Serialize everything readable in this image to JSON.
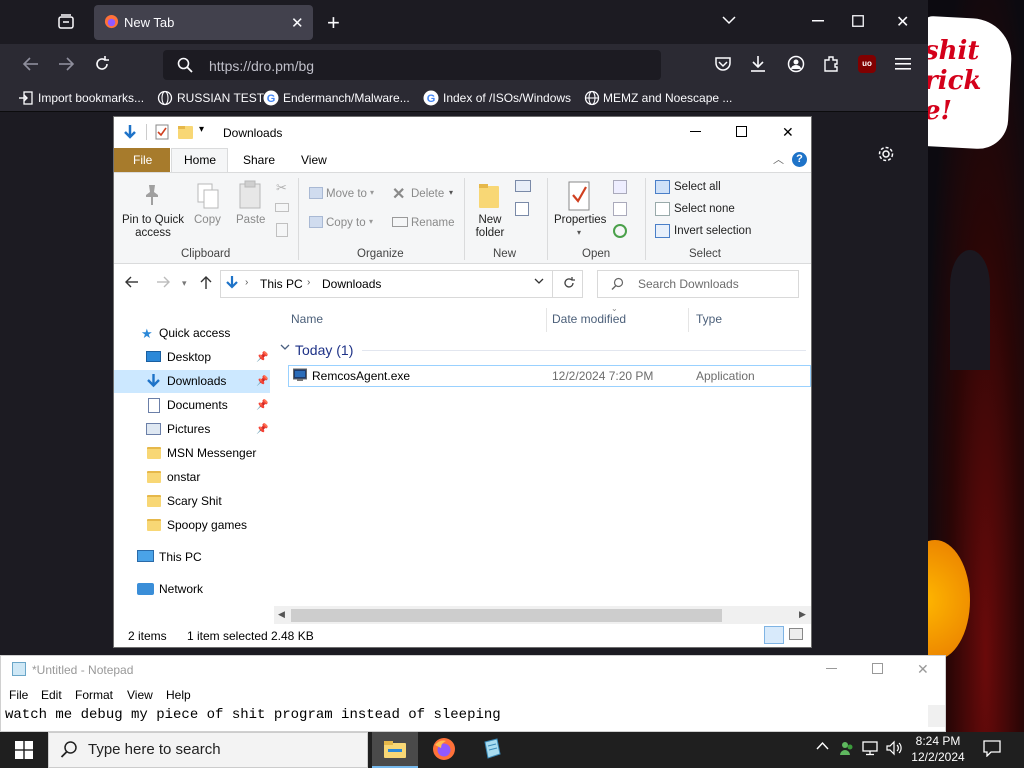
{
  "background_page": {
    "bubble_text": "shit\nrick\ne!"
  },
  "browser": {
    "tab": {
      "title": "New Tab"
    },
    "url": "https://dro.pm/bg",
    "bookmarks": [
      {
        "label": "Import bookmarks...",
        "icon": "import-icon"
      },
      {
        "label": "RUSSIAN TEST",
        "icon": "globe-icon"
      },
      {
        "label": "Endermanch/Malware...",
        "icon": "google-icon"
      },
      {
        "label": "Index of /ISOs/Windows",
        "icon": "google-icon"
      },
      {
        "label": "MEMZ and Noescape ...",
        "icon": "globe-icon"
      }
    ],
    "colors": {
      "tab_bg": "#1c1b22",
      "active_tab": "#42414d",
      "toolbar": "#2b2a33"
    }
  },
  "explorer": {
    "title": "Downloads",
    "tabs": {
      "file": "File",
      "home": "Home",
      "share": "Share",
      "view": "View"
    },
    "ribbon": {
      "clipboard": {
        "pin": "Pin to Quick access",
        "copy": "Copy",
        "paste": "Paste",
        "group": "Clipboard"
      },
      "organize": {
        "move_to": "Move to",
        "copy_to": "Copy to",
        "delete": "Delete",
        "rename": "Rename",
        "group": "Organize"
      },
      "new": {
        "new_folder": "New folder",
        "group": "New"
      },
      "open": {
        "properties": "Properties",
        "group": "Open"
      },
      "select": {
        "select_all": "Select all",
        "select_none": "Select none",
        "invert": "Invert selection",
        "group": "Select"
      }
    },
    "address": {
      "crumbs": [
        "This PC",
        "Downloads"
      ]
    },
    "search_placeholder": "Search Downloads",
    "nav": [
      {
        "label": "Quick access",
        "icon": "star-icon"
      },
      {
        "label": "Desktop",
        "icon": "desktop-icon",
        "pinned": true
      },
      {
        "label": "Downloads",
        "icon": "download-icon",
        "pinned": true,
        "selected": true
      },
      {
        "label": "Documents",
        "icon": "documents-icon",
        "pinned": true
      },
      {
        "label": "Pictures",
        "icon": "pictures-icon",
        "pinned": true
      },
      {
        "label": "MSN Messenger",
        "icon": "folder-icon"
      },
      {
        "label": "onstar",
        "icon": "folder-icon"
      },
      {
        "label": "Scary Shit",
        "icon": "folder-icon"
      },
      {
        "label": "Spoopy games",
        "icon": "folder-icon"
      },
      {
        "label": "This PC",
        "icon": "computer-icon"
      },
      {
        "label": "Network",
        "icon": "network-icon"
      }
    ],
    "columns": [
      "Name",
      "Date modified",
      "Type"
    ],
    "group_header": "Today (1)",
    "files": [
      {
        "name": "RemcosAgent.exe",
        "date": "12/2/2024 7:20 PM",
        "type": "Application"
      }
    ],
    "status": {
      "items": "2 items",
      "selected": "1 item selected",
      "size": "2.48 KB"
    }
  },
  "notepad": {
    "title": "*Untitled - Notepad",
    "menu": [
      "File",
      "Edit",
      "Format",
      "View",
      "Help"
    ],
    "text": "watch me debug my piece of shit program instead of sleeping"
  },
  "taskbar": {
    "search_placeholder": "Type here to search",
    "time": "8:24 PM",
    "date": "12/2/2024"
  }
}
